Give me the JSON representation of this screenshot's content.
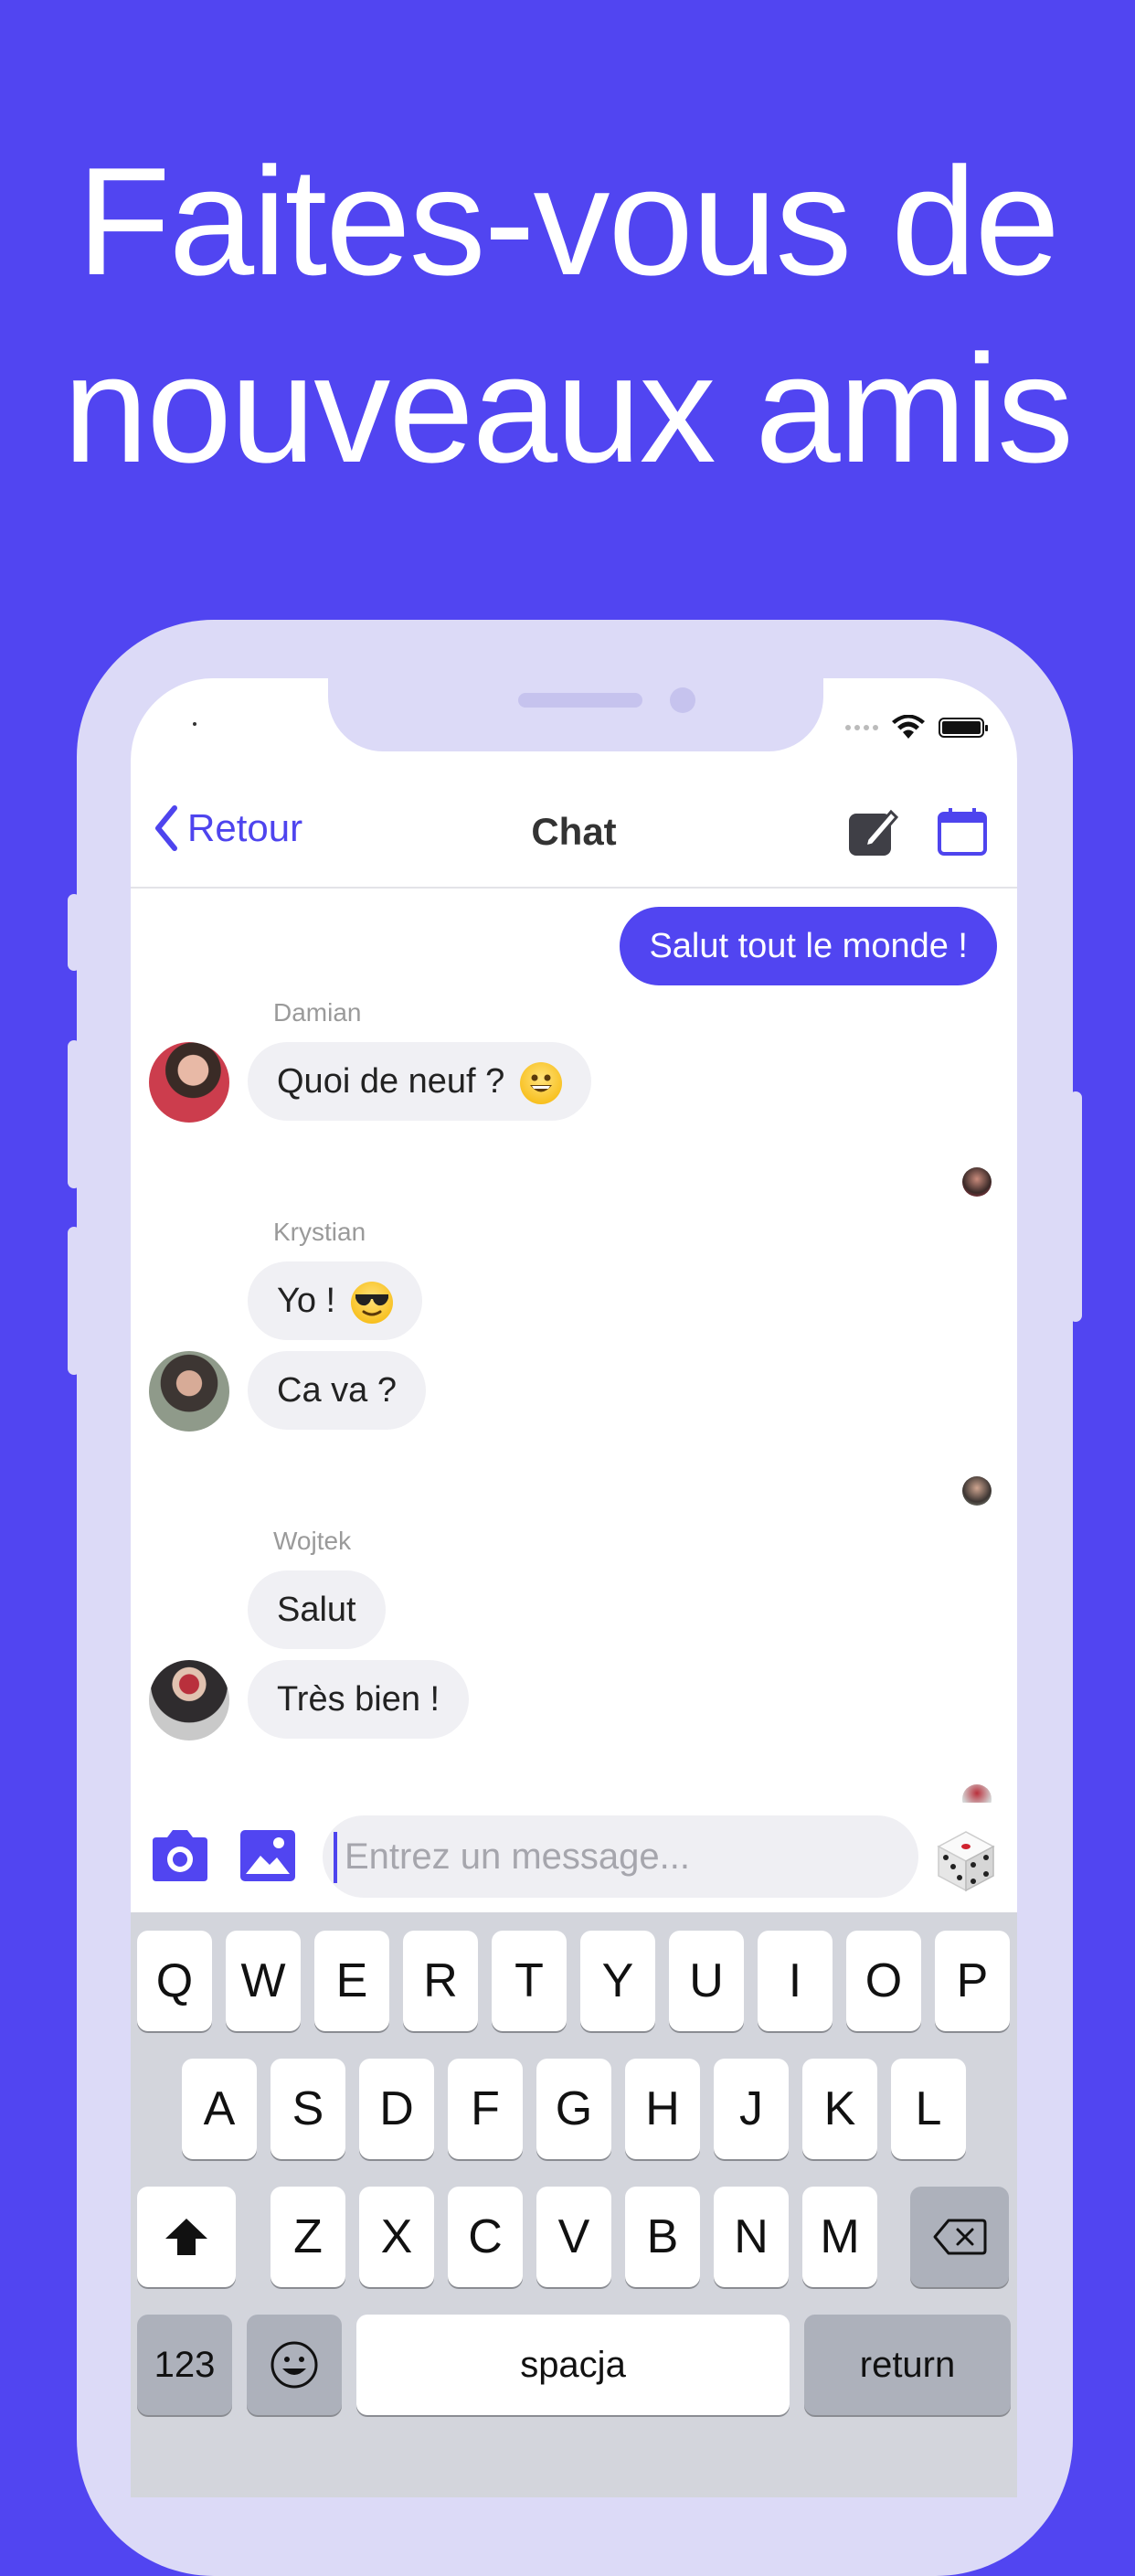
{
  "headline": [
    "Faites-vous de",
    "nouveaux amis"
  ],
  "colors": {
    "background": "#5145F1",
    "accent": "#4E44EE",
    "phone_frame": "#DCDAF7",
    "bubble_in": "#F0F0F4"
  },
  "nav": {
    "back_label": "Retour",
    "title": "Chat",
    "icons": [
      "compose-icon",
      "calendar-icon"
    ]
  },
  "messages": {
    "outgoing": "Salut tout le monde !",
    "damian": {
      "name": "Damian",
      "text": "Quoi de neuf ?"
    },
    "krystian": {
      "name": "Krystian",
      "texts": [
        "Yo !",
        "Ca va ?"
      ]
    },
    "wojtek": {
      "name": "Wojtek",
      "texts": [
        "Salut",
        "Très bien !"
      ]
    }
  },
  "composer": {
    "placeholder": "Entrez un message...",
    "icons": [
      "camera-icon",
      "image-icon",
      "dice-icon"
    ]
  },
  "keyboard": {
    "row1": [
      "Q",
      "W",
      "E",
      "R",
      "T",
      "Y",
      "U",
      "I",
      "O",
      "P"
    ],
    "row2": [
      "A",
      "S",
      "D",
      "F",
      "G",
      "H",
      "J",
      "K",
      "L"
    ],
    "row3": [
      "Z",
      "X",
      "C",
      "V",
      "B",
      "N",
      "M"
    ],
    "numbers": "123",
    "space": "spacja",
    "return": "return"
  }
}
